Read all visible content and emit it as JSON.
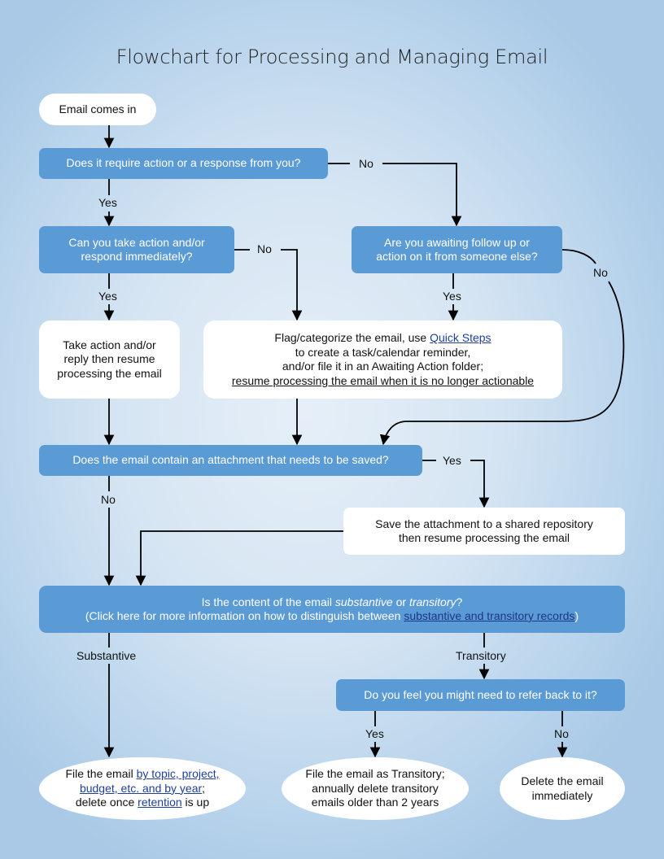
{
  "title": "Flowchart for Processing and Managing Email",
  "nodes": {
    "start": "Email comes in",
    "q_action": "Does it require action or a response from you?",
    "q_immediate": [
      "Can you take action and/or",
      "respond immediately?"
    ],
    "q_awaiting": [
      "Are you awaiting follow up or",
      "action on it from someone else?"
    ],
    "take_action": [
      "Take action and/or",
      "reply then resume",
      "processing the email"
    ],
    "flag": {
      "line1_prefix": "Flag/categorize the email, use ",
      "line1_link": "Quick Steps",
      "line2": "to create a task/calendar reminder,",
      "line3": "and/or file it in an Awaiting Action folder;",
      "line4": "resume processing the email when it is no longer actionable"
    },
    "q_attachment": "Does the email contain an attachment that needs to be saved?",
    "save_attachment": [
      "Save the attachment to a shared repository",
      "then resume processing the email"
    ],
    "q_content": {
      "line1_prefix": "Is the content of the email ",
      "line1_em1": "substantive",
      "line1_mid": " or ",
      "line1_em2": "transitory",
      "line1_suffix": "?",
      "line2_prefix": "(Click here for more information on how to distinguish between ",
      "line2_link": "substantive and transitory records",
      "line2_suffix": ")"
    },
    "q_refer": "Do you feel you might need to refer back to it?",
    "file_email": {
      "prefix": "File the email ",
      "link1a": "by topic, project,",
      "link1b": "budget, etc. and by year",
      "mid": ";",
      "line3_prefix": "delete once ",
      "link2": "retention",
      "line3_suffix": " is up"
    },
    "file_transitory": [
      "File the email as Transitory;",
      "annually delete transitory",
      "emails older than 2 years"
    ],
    "delete_email": [
      "Delete the email",
      "immediately"
    ]
  },
  "labels": {
    "no1": "No",
    "yes1": "Yes",
    "no2": "No",
    "yes2": "Yes",
    "no3": "No",
    "yes3": "Yes",
    "yes4": "Yes",
    "no4": "No",
    "substantive": "Substantive",
    "transitory": "Transitory",
    "yes5": "Yes",
    "no5": "No"
  }
}
